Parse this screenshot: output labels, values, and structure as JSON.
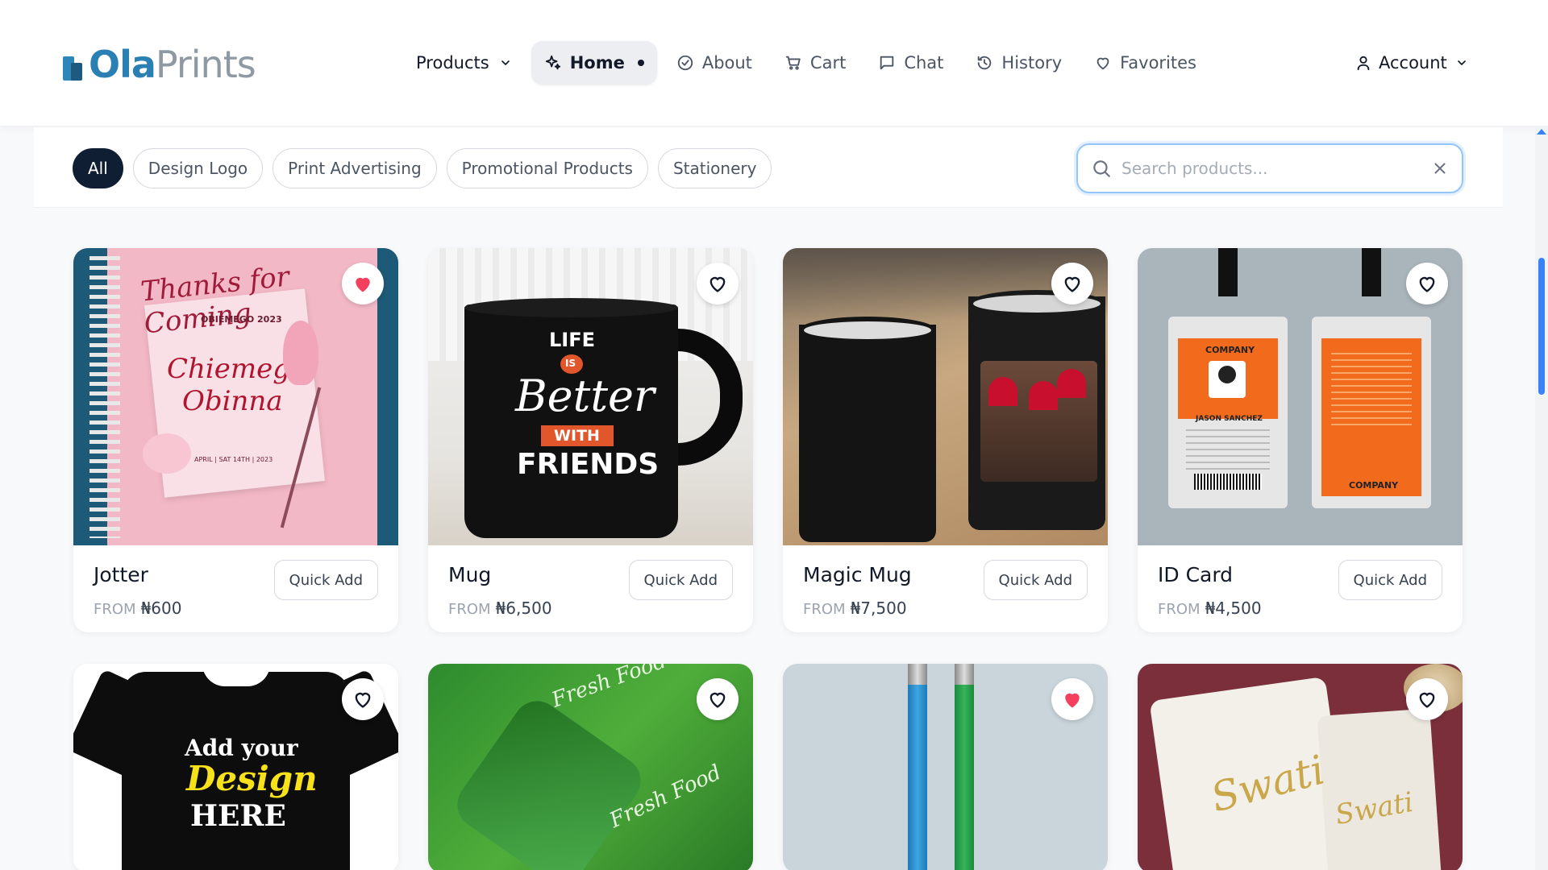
{
  "brand": {
    "part1": "Ola",
    "part2": "Prints"
  },
  "nav": {
    "products": "Products",
    "home": "Home",
    "about": "About",
    "cart": "Cart",
    "chat": "Chat",
    "history": "History",
    "favorites": "Favorites",
    "account": "Account"
  },
  "filters": {
    "chips": [
      "All",
      "Design Logo",
      "Print Advertising",
      "Promotional Products",
      "Stationery"
    ],
    "active": "All"
  },
  "search": {
    "placeholder": "Search products...",
    "value": ""
  },
  "quick_add_label": "Quick Add",
  "price_prefix": "FROM",
  "products": [
    {
      "name": "Jotter",
      "price": "₦600",
      "favorited": true
    },
    {
      "name": "Mug",
      "price": "₦6,500",
      "favorited": false
    },
    {
      "name": "Magic Mug",
      "price": "₦7,500",
      "favorited": false
    },
    {
      "name": "ID Card",
      "price": "₦4,500",
      "favorited": false
    },
    {
      "name": "",
      "price": "",
      "favorited": false
    },
    {
      "name": "",
      "price": "",
      "favorited": false
    },
    {
      "name": "",
      "price": "",
      "favorited": true
    },
    {
      "name": "",
      "price": "",
      "favorited": false
    }
  ],
  "image_text": {
    "jotter_script": "Thanks for Coming",
    "jotter_event": "OBIEMEGO 2023",
    "jotter_names_1": "Chiemego",
    "jotter_names_2": "Obinna",
    "jotter_date": "APRIL | SAT 14TH | 2023",
    "mug_line1": "LIFE",
    "mug_line2": "IS",
    "mug_line3": "Better",
    "mug_line4": "WITH",
    "mug_line5": "FRIENDS",
    "id_company": "COMPANY",
    "id_name": "JASON SANCHEZ",
    "tshirt_1": "Add your",
    "tshirt_2": "Design",
    "tshirt_3": "HERE",
    "wrap_1": "Fresh Food",
    "towel": "Swati"
  },
  "colors": {
    "accent": "#2a7fb3",
    "chip_active": "#0f1e33",
    "fav_active": "#f43f5e",
    "search_border": "#93c5fd"
  }
}
